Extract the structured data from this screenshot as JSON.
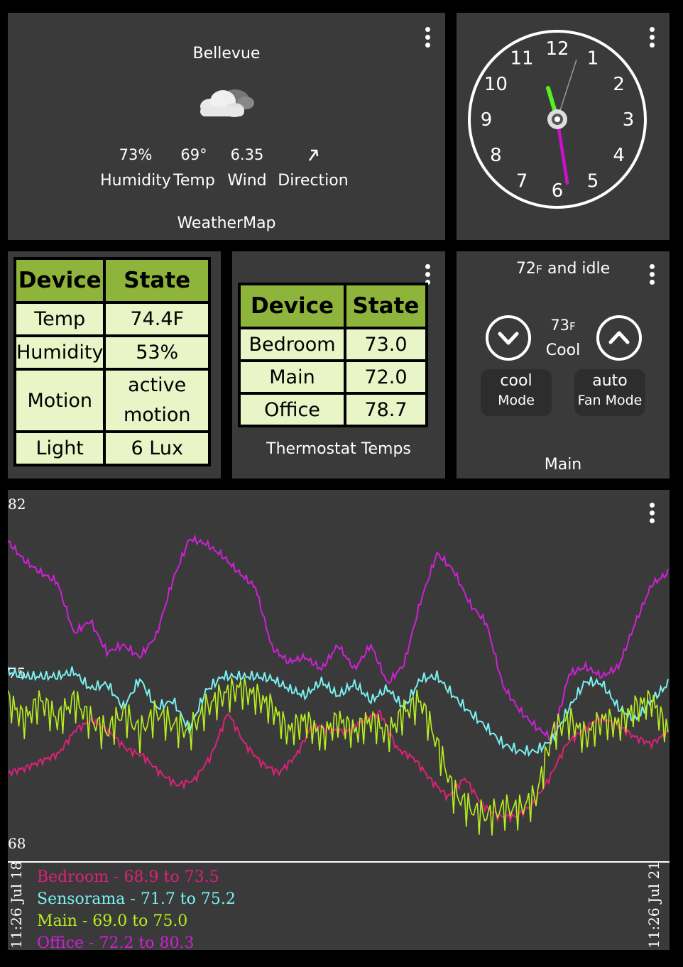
{
  "weather": {
    "city": "Bellevue",
    "icon": "partly-cloudy-icon",
    "humidity": "73%",
    "humidity_label": "Humidity",
    "temp": "69°",
    "temp_label": "Temp",
    "wind": "6.35",
    "wind_label": "Wind",
    "direction_label": "Direction",
    "title": "WeatherMap"
  },
  "clock": {
    "numbers": [
      "12",
      "1",
      "2",
      "3",
      "4",
      "5",
      "6",
      "7",
      "8",
      "9",
      "10",
      "11"
    ],
    "hour_color": "#55ee22",
    "minute_color": "#cc11cc"
  },
  "sensor": {
    "headers": [
      "Device",
      "State"
    ],
    "rows": [
      [
        "Temp",
        "74.4F"
      ],
      [
        "Humidity",
        "53%"
      ],
      [
        "Motion",
        "active motion"
      ],
      [
        "Light",
        "6 Lux"
      ]
    ]
  },
  "thermo_temps": {
    "headers": [
      "Device",
      "State"
    ],
    "rows": [
      [
        "Bedroom",
        "73.0"
      ],
      [
        "Main",
        "72.0"
      ],
      [
        "Office",
        "78.7"
      ]
    ],
    "title": "Thermostat Temps"
  },
  "thermostat": {
    "status_num": "72",
    "status_unit": "F",
    "status_text": " and idle",
    "setpoint_num": "73",
    "setpoint_unit": "F",
    "state": "Cool",
    "mode_value": "cool",
    "mode_label": "Mode",
    "fan_value": "auto",
    "fan_label": "Fan Mode",
    "name": "Main"
  },
  "chart_data": {
    "type": "line",
    "ylim": [
      68,
      82
    ],
    "y_ticks": [
      "82",
      "75",
      "68"
    ],
    "x_start": "11:26 Jul 18",
    "x_end": "11:26 Jul 21",
    "series": [
      {
        "name": "Bedroom",
        "range": "Bedroom - 68.9 to 73.5",
        "color": "#e0207a",
        "values": [
          70.8,
          71.0,
          71.3,
          71.6,
          72.6,
          73.0,
          72.5,
          71.8,
          71.5,
          70.8,
          70.3,
          70.5,
          71.5,
          73.3,
          72.0,
          71.2,
          70.8,
          71.5,
          72.8,
          72.6,
          72.5,
          73.0,
          73.3,
          71.8,
          71.4,
          70.5,
          69.8,
          70.6,
          69.5,
          69.0,
          69.0,
          69.5,
          70.6,
          72.0,
          72.6,
          73.1,
          72.8,
          72.3,
          72.0,
          72.5
        ]
      },
      {
        "name": "Sensorama",
        "range": "Sensorama - 71.7 to 75.2",
        "color": "#7af0f0",
        "values": [
          75.0,
          74.8,
          74.8,
          74.8,
          75.0,
          74.3,
          74.5,
          73.5,
          74.7,
          73.5,
          73.8,
          72.6,
          74.2,
          74.8,
          74.8,
          74.8,
          74.7,
          74.3,
          74.0,
          74.6,
          74.0,
          74.5,
          73.8,
          74.3,
          73.5,
          74.7,
          74.8,
          74.0,
          73.3,
          72.7,
          72.0,
          71.7,
          71.7,
          72.2,
          73.5,
          74.6,
          74.5,
          73.5,
          73.0,
          73.8,
          74.5
        ]
      },
      {
        "name": "Main",
        "range": "Main - 69.0 to 75.0",
        "color": "#b8f020",
        "values": [
          73.8,
          73.0,
          73.8,
          73.0,
          73.8,
          73.0,
          72.5,
          73.3,
          72.5,
          73.3,
          72.8,
          72.5,
          73.5,
          74.0,
          74.3,
          74.0,
          73.5,
          72.5,
          73.0,
          72.3,
          73.0,
          72.5,
          73.0,
          72.4,
          73.3,
          73.8,
          72.0,
          70.0,
          69.3,
          69.0,
          69.3,
          69.3,
          69.8,
          72.5,
          73.0,
          72.3,
          73.0,
          72.8,
          73.5,
          73.8,
          72.5
        ]
      },
      {
        "name": "Office",
        "range": "Office - 72.2 to 80.3",
        "color": "#d020d8",
        "values": [
          80.4,
          79.6,
          79.1,
          78.7,
          76.6,
          77.1,
          75.8,
          76.1,
          75.6,
          76.5,
          78.8,
          80.5,
          80.3,
          79.8,
          79.1,
          78.5,
          76.0,
          75.4,
          75.6,
          75.1,
          76.1,
          75.1,
          76.1,
          74.5,
          75.3,
          77.9,
          79.9,
          79.2,
          77.8,
          77.0,
          74.4,
          73.4,
          72.7,
          72.2,
          74.9,
          75.2,
          74.8,
          75.2,
          77.0,
          78.6,
          79.1
        ]
      }
    ]
  }
}
